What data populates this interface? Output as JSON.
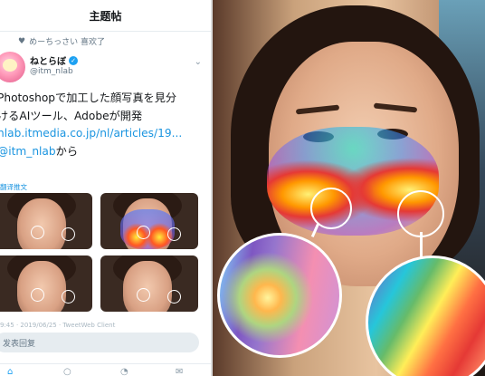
{
  "header": {
    "title": "主题帖"
  },
  "activity": {
    "liked_by": "めーちっさい 喜欢了"
  },
  "user": {
    "display_name": "ねとらぼ",
    "handle": "@itm_nlab"
  },
  "tweet": {
    "line1": "Photoshopで加工した顔写真を見分",
    "line2": "けるAIツール、Adobeが開発",
    "link": "nlab.itmedia.co.jp/nl/articles/19...",
    "mention": "@itm_nlab",
    "suffix": "から"
  },
  "translate_label": "翻译推文",
  "meta": "9:45 · 2019/06/25 · TweetWeb Client",
  "reply": {
    "placeholder": "发表回复"
  },
  "colors": {
    "accent": "#1b95e0",
    "verified": "#1da1f2"
  },
  "icons": [
    "heart-icon",
    "verified-icon",
    "chevron-down-icon",
    "home-icon",
    "search-icon",
    "notifications-icon",
    "messages-icon"
  ]
}
